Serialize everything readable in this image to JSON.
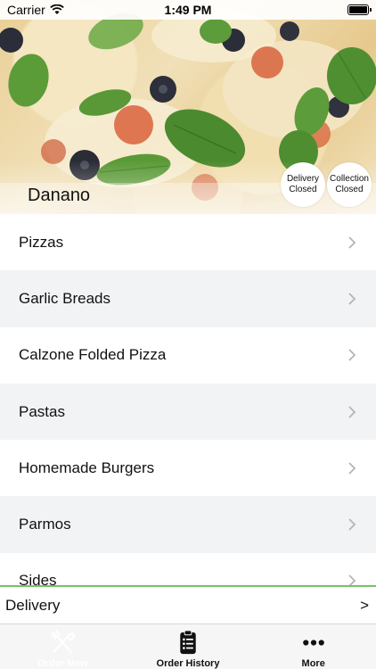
{
  "status_bar": {
    "carrier": "Carrier",
    "time": "1:49 PM"
  },
  "restaurant": {
    "name": "Danano",
    "badges": {
      "delivery": [
        "Delivery",
        "Closed"
      ],
      "collection": [
        "Collection",
        "Closed"
      ]
    }
  },
  "categories": [
    "Pizzas",
    "Garlic Breads",
    "Calzone Folded Pizza",
    "Pastas",
    "Homemade Burgers",
    "Parmos",
    "Sides"
  ],
  "delivery_bar": {
    "label": "Delivery",
    "arrow": ">"
  },
  "tabs": [
    {
      "label": "Order Now",
      "icon": "fork-knife-icon",
      "active": true
    },
    {
      "label": "Order History",
      "icon": "clipboard-list-icon",
      "active": false
    },
    {
      "label": "More",
      "icon": "more-dots-icon",
      "active": false
    }
  ],
  "colors": {
    "accent_line": "#7bbf6a",
    "row_alt": "#f2f3f5",
    "tab_bar": "#f6f6f6"
  }
}
